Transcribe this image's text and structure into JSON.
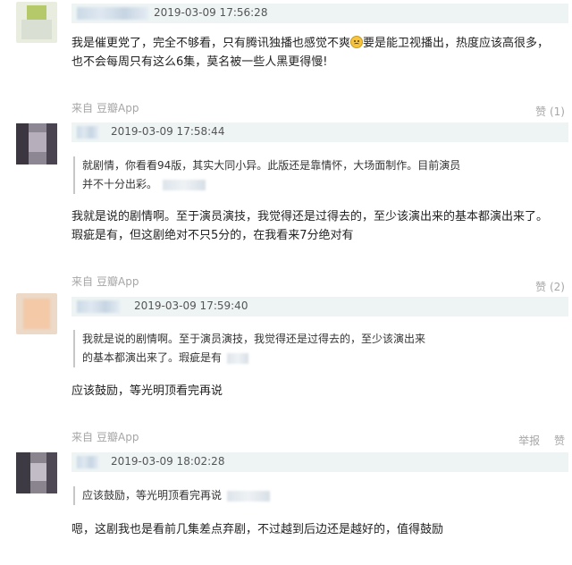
{
  "comments": [
    {
      "timestamp": "2019-03-09 17:56:28",
      "text": "我是催更党了，完全不够看，只有腾讯独播也感觉不爽",
      "text_after_emoji": "要是能卫视播出，热度应该高很多，也不会每周只有这么6集，莫名被一些人黑更得慢!",
      "emoji_icon": "sad-face-icon",
      "source_prefix": "来自",
      "source_app": "豆瓣App",
      "like_label": "赞 (1)"
    },
    {
      "timestamp": "2019-03-09 17:58:44",
      "quote": "就剧情，你看看94版，其实大同小异。此版还是靠情怀，大场面制作。目前演员并不十分出彩。",
      "text": "我就是说的剧情啊。至于演员演技，我觉得还是过得去的，至少该演出来的基本都演出来了。瑕疵是有，但这剧绝对不只5分的，在我看来7分绝对有",
      "source_prefix": "来自",
      "source_app": "豆瓣App",
      "like_label": "赞 (2)"
    },
    {
      "timestamp": "2019-03-09 17:59:40",
      "quote": "我就是说的剧情啊。至于演员演技，我觉得还是过得去的，至少该演出来的基本都演出来了。瑕疵是有",
      "text": "应该鼓励，等光明顶看完再说",
      "source_prefix": "来自",
      "source_app": "豆瓣App",
      "report_label": "举报",
      "like_label": "赞"
    },
    {
      "timestamp": "2019-03-09 18:02:28",
      "quote": "应该鼓励，等光明顶看完再说",
      "text": "嗯，这剧我也是看前几集差点弃剧，不过越到后边还是越好的，值得鼓励"
    }
  ],
  "colors": {
    "meta_bar": "#eef4f4",
    "muted_text": "#a6a6a6",
    "body_text": "#222222"
  }
}
